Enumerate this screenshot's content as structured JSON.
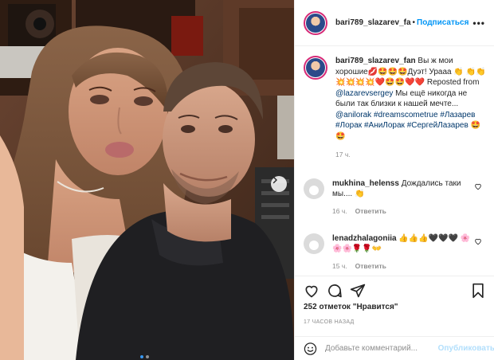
{
  "post": {
    "username": "bari789_slazarev_fan",
    "header_username": "bari789_slazarev_fa",
    "separator": "•",
    "follow_label": "Подписаться",
    "more_label": "•••",
    "caption": {
      "username": "bari789_slazarev_fan",
      "line1": " Вы ж мои хорошие💋🤩🤩🤩Дуэт! Урааа 👏",
      "line2": "👏👏💥💥💥💥❤️🤩🤩❤️❤️",
      "reposted_prefix": "Reposted from ",
      "reposted_user": "@lazarevsergey",
      "reposted_text": " Мы ещё никогда не были так близки к нашей мечте... ",
      "mention": "@anilorak",
      "tags": "#dreamscometrue #Лазарев #Лорак #АниЛорак #СергейЛазарев",
      "tags_tail": " 🤩🤩",
      "time": "17 ч."
    },
    "comments": [
      {
        "username": "mukhina_helenss",
        "text": " Дождались таки мы.... 👏",
        "time": "16 ч.",
        "reply_label": "Ответить"
      },
      {
        "username": "lenadzhalagoniia",
        "text": " 👍👍👍🖤🖤🖤 🌸🌸🌸🌹🌹👐",
        "time": "15 ч.",
        "reply_label": "Ответить"
      }
    ],
    "likes_text": "252 отметок \"Нравится\"",
    "posted_time": "17 ЧАСОВ НАЗАД",
    "comment_placeholder": "Добавьте комментарий...",
    "publish_label": "Опубликовать",
    "carousel": {
      "count": 2,
      "active": 0
    }
  },
  "icons": {
    "heart": "heart-icon",
    "comment": "comment-icon",
    "share": "share-icon",
    "save": "bookmark-icon",
    "emoji": "smiley-icon",
    "next": "chevron-right-icon"
  },
  "colors": {
    "accent": "#0095f6",
    "link": "#00376b",
    "muted": "#8e8e8e",
    "publish_disabled": "#b2dffc"
  }
}
